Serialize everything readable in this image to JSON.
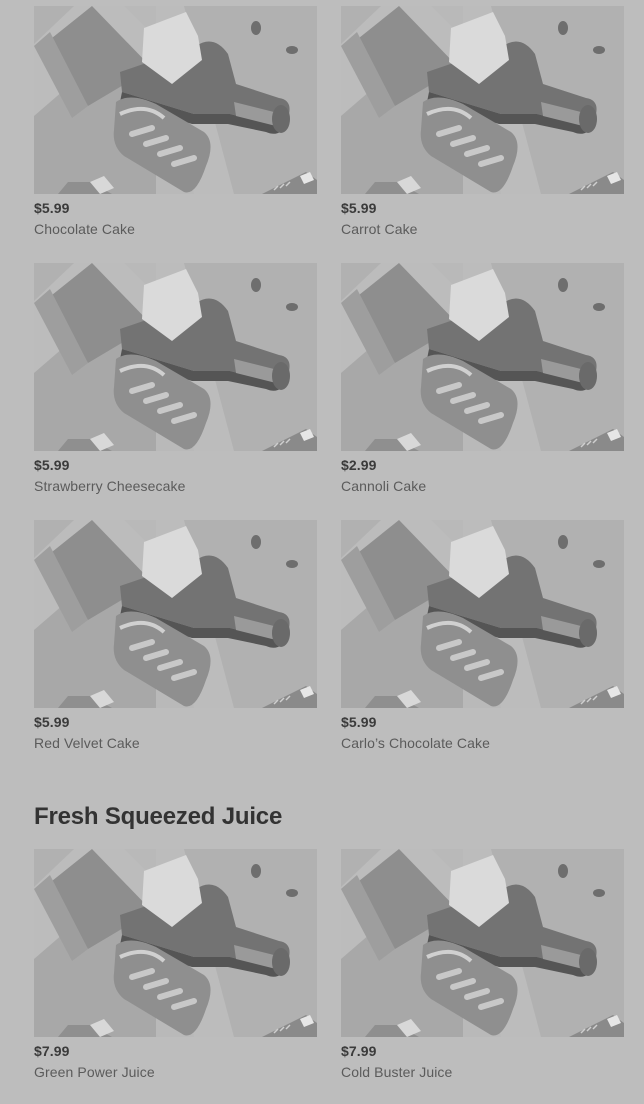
{
  "sections": [
    {
      "title": "",
      "items": [
        {
          "price": "$5.99",
          "name": "Chocolate Cake"
        },
        {
          "price": "$5.99",
          "name": "Carrot Cake"
        },
        {
          "price": "$5.99",
          "name": "Strawberry Cheesecake"
        },
        {
          "price": "$2.99",
          "name": "Cannoli Cake"
        },
        {
          "price": "$5.99",
          "name": "Red Velvet Cake"
        },
        {
          "price": "$5.99",
          "name": "Carlo’s Chocolate Cake"
        }
      ]
    },
    {
      "title": "Fresh Squeezed Juice",
      "items": [
        {
          "price": "$7.99",
          "name": "Green Power Juice"
        },
        {
          "price": "$7.99",
          "name": "Cold Buster Juice"
        }
      ]
    }
  ],
  "placeholder_image_icon": "food-placeholder-icon",
  "colors": {
    "background": "#bdbdbd",
    "image_background": "#b1b1b1",
    "price_text": "#3b3b3b",
    "name_text": "#5b5b5b",
    "heading_text": "#333333"
  }
}
